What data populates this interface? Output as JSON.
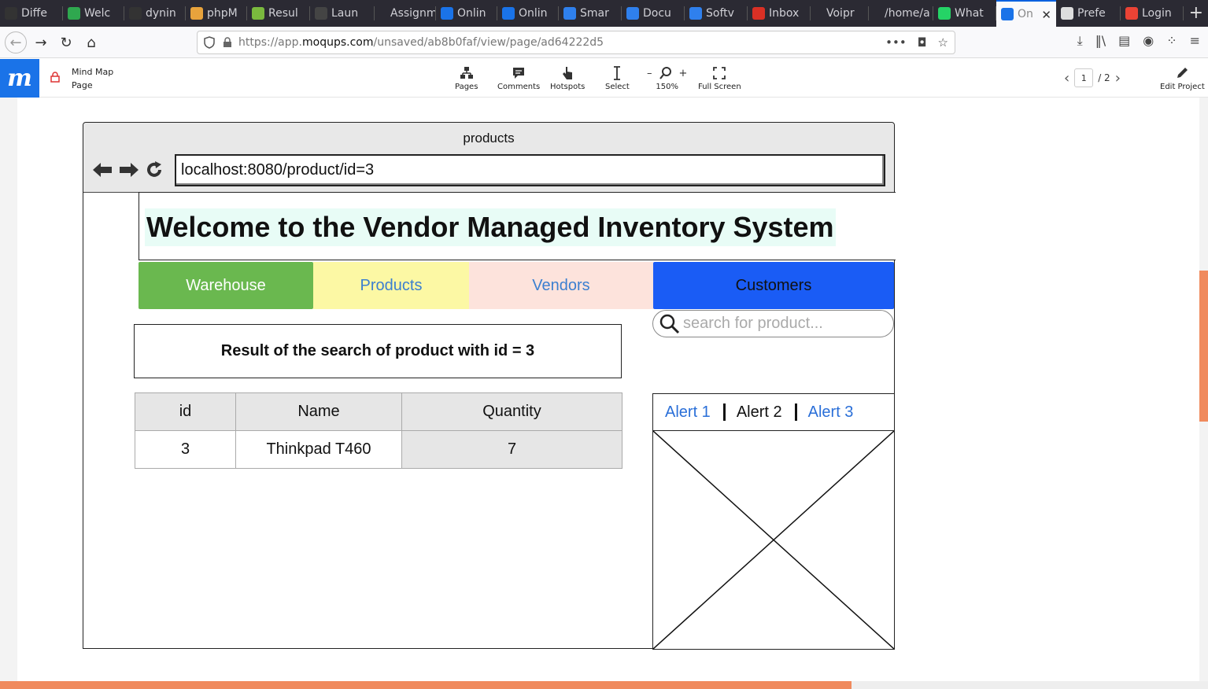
{
  "browser": {
    "tabs": [
      {
        "label": "Diffe",
        "fav": "github-icon",
        "color": "#333"
      },
      {
        "label": "Welc",
        "fav": "trello-icon",
        "color": "#2fa84f"
      },
      {
        "label": "dynin",
        "fav": "github-icon",
        "color": "#333"
      },
      {
        "label": "phpM",
        "fav": "phpmyadmin-icon",
        "color": "#e8a33c"
      },
      {
        "label": "Resul",
        "fav": "spring-icon",
        "color": "#7ab93e"
      },
      {
        "label": "Laun",
        "fav": "launch-icon",
        "color": "#444"
      },
      {
        "label": "Assignm",
        "fav": "",
        "color": ""
      },
      {
        "label": "Onlin",
        "fav": "moqups-icon",
        "color": "#1a73e8"
      },
      {
        "label": "Onlin",
        "fav": "moqups-icon",
        "color": "#1a73e8"
      },
      {
        "label": "Smar",
        "fav": "confluence-icon",
        "color": "#2f80ed"
      },
      {
        "label": "Docu",
        "fav": "confluence-icon",
        "color": "#2f80ed"
      },
      {
        "label": "Softv",
        "fav": "confluence-icon",
        "color": "#2f80ed"
      },
      {
        "label": "Inbox",
        "fav": "gmail-icon",
        "color": "#d93025"
      },
      {
        "label": "Voipr",
        "fav": "",
        "color": ""
      },
      {
        "label": "/home/a",
        "fav": "",
        "color": ""
      },
      {
        "label": "What",
        "fav": "whatsapp-icon",
        "color": "#25d366"
      },
      {
        "label": "On",
        "fav": "moqups-icon",
        "color": "#1a73e8"
      },
      {
        "label": "Prefe",
        "fav": "gear-icon",
        "color": "#ddd"
      },
      {
        "label": "Login",
        "fav": "google-icon",
        "color": "#ea4335"
      }
    ],
    "active_tab_index": 16,
    "new_tab": "+",
    "url_prefix": "https://app.",
    "url_host": "moqups.com",
    "url_path": "/unsaved/ab8b0faf/view/page/ad64222d5",
    "url_more": "•••"
  },
  "moqups": {
    "logo": "m",
    "project_title": "Mind Map",
    "page_label": "Page",
    "tools": [
      {
        "label": "Pages",
        "icon": "sitemap-icon"
      },
      {
        "label": "Comments",
        "icon": "comment-icon"
      },
      {
        "label": "Hotspots",
        "icon": "hand-pointer-icon"
      },
      {
        "label": "Select",
        "icon": "text-cursor-icon"
      },
      {
        "label": "150%",
        "icon": "zoom-icon"
      },
      {
        "label": "Full Screen",
        "icon": "fullscreen-icon"
      }
    ],
    "zoom_minus": "–",
    "zoom_plus": "+",
    "page_current": "1",
    "page_total": "/ 2",
    "edit_label": "Edit Project"
  },
  "wireframe": {
    "window_title": "products",
    "address": "localhost:8080/product/id=3",
    "banner": "Welcome to the Vendor Managed Inventory System",
    "nav": {
      "warehouse": "Warehouse",
      "products": "Products",
      "vendors": "Vendors",
      "customers": "Customers"
    },
    "search_placeholder": "search for product...",
    "result_heading": "Result of the search of product with id = 3",
    "table": {
      "headers": [
        "id",
        "Name",
        "Quantity"
      ],
      "rows": [
        [
          "3",
          "Thinkpad T460",
          "7"
        ]
      ]
    },
    "alerts": [
      "Alert 1",
      "Alert 2",
      "Alert 3"
    ]
  }
}
